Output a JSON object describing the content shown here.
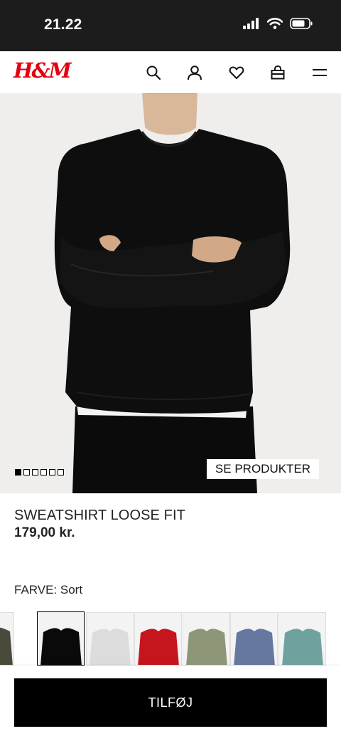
{
  "status_bar": {
    "time": "21.22"
  },
  "header": {
    "logo": "H&M",
    "icons": [
      "search-icon",
      "account-icon",
      "favorites-icon",
      "bag-icon",
      "menu-icon"
    ]
  },
  "hero": {
    "cta_label": "SE PRODUKTER",
    "image_count": 6,
    "active_index": 0
  },
  "product": {
    "name": "SWEATSHIRT LOOSE FIT",
    "price": "179,00 kr."
  },
  "color_selector": {
    "label": "FARVE: Sort",
    "swatches": [
      {
        "color": "#4a4a3c"
      },
      {
        "color": "#0a0a0a",
        "selected": true
      },
      {
        "color": "#dcdcdc"
      },
      {
        "color": "#c4161c"
      },
      {
        "color": "#8d9677"
      },
      {
        "color": "#6677a0"
      },
      {
        "color": "#6fa29f"
      }
    ]
  },
  "actions": {
    "add_label": "TILFØJ"
  },
  "colors": {
    "brand": "#e50010",
    "button": "#000000",
    "status_bar": "#1c1c1c"
  }
}
